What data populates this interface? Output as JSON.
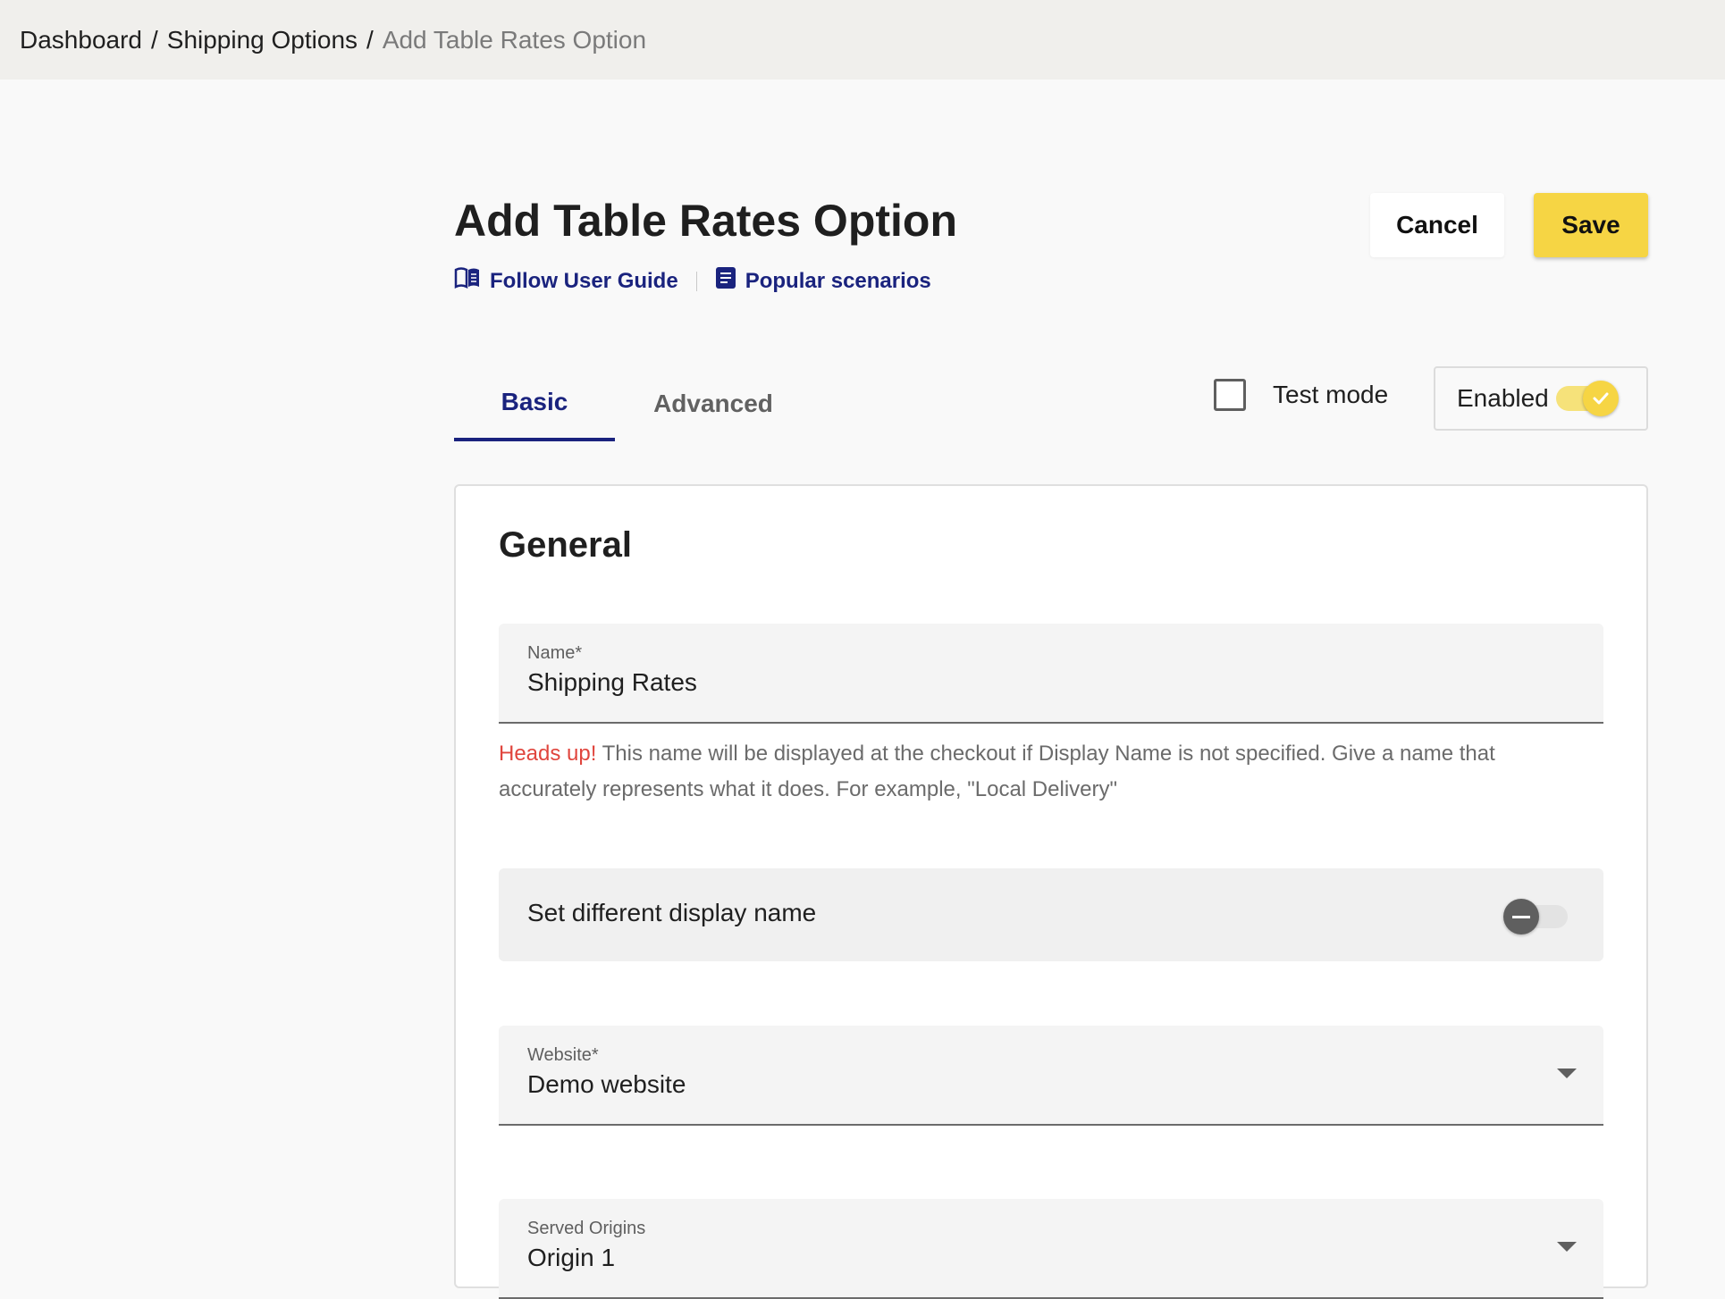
{
  "breadcrumb": {
    "items": [
      "Dashboard",
      "Shipping Options",
      "Add Table Rates Option"
    ],
    "separator": "/"
  },
  "page": {
    "title": "Add Table Rates Option",
    "links": [
      {
        "label": "Follow User Guide",
        "icon": "book-icon"
      },
      {
        "label": "Popular scenarios",
        "icon": "document-icon"
      }
    ]
  },
  "actions": {
    "cancel_label": "Cancel",
    "save_label": "Save"
  },
  "tabs": [
    {
      "label": "Basic",
      "active": true
    },
    {
      "label": "Advanced",
      "active": false
    }
  ],
  "test_mode": {
    "label": "Test mode",
    "checked": false
  },
  "enabled": {
    "label": "Enabled",
    "on": true
  },
  "general": {
    "title": "General",
    "name_field": {
      "label": "Name*",
      "value": "Shipping Rates"
    },
    "helper": {
      "warning": "Heads up!",
      "text": " This name will be displayed at the checkout if Display Name is not specified. Give a name that accurately represents what it does. For example, \"Local Delivery\""
    },
    "display_name": {
      "label": "Set different display name",
      "on": false
    },
    "website_field": {
      "label": "Website*",
      "value": "Demo website"
    },
    "origins_field": {
      "label": "Served Origins",
      "value": "Origin 1"
    }
  },
  "colors": {
    "accent": "#1a237e",
    "save_button": "#f6d544",
    "warning": "#e0453d",
    "topbar": "#f0efec"
  }
}
